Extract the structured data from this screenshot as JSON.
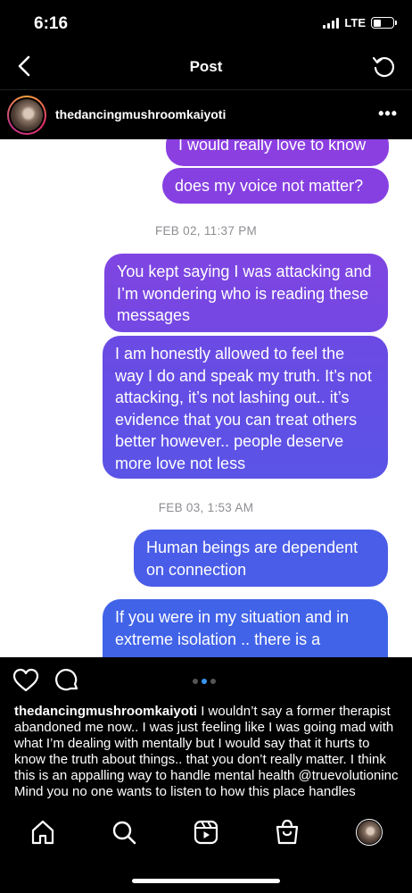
{
  "status_bar": {
    "time": "6:16",
    "network": "LTE",
    "battery_level": 0.4
  },
  "nav": {
    "title": "Post",
    "back_icon": "chevron-left-icon",
    "refresh_icon": "refresh-icon"
  },
  "author": {
    "username": "thedancingmushroomkaiyoti",
    "more_icon": "more-horizontal-icon",
    "more_label": "•••"
  },
  "post_image": {
    "messages": [
      {
        "text": "I would really love to know"
      },
      {
        "text": "does my voice not matter?"
      },
      {
        "timestamp": "FEB 02, 11:37 PM"
      },
      {
        "text": "You kept saying I was attacking and I’m wondering who is reading these messages"
      },
      {
        "text": "I am honestly allowed to feel the way I do and speak my truth. It’s not attacking, it’s not lashing out.. it’s evidence that you can treat others better however.. people deserve more love not less"
      },
      {
        "timestamp": "FEB 03, 1:53 AM"
      },
      {
        "text": "Human beings are dependent on connection"
      },
      {
        "text": "If you were in my situation and in extreme isolation .. there is a"
      }
    ]
  },
  "actions": {
    "like_icon": "heart-icon",
    "comment_icon": "comment-icon",
    "carousel": {
      "count": 3,
      "active_index": 1
    }
  },
  "caption": {
    "username": "thedancingmushroomkaiyoti",
    "text": "I wouldn’t say a former therapist abandoned me now.. I was just feeling like I was going mad with what I’m dealing with mentally but I would say that it hurts to know the truth about things.. that you don’t really matter. I think this is an appalling way to handle mental health @truevolutioninc",
    "text_more": "Mind you no one wants to listen to how this place handles"
  },
  "tabbar": {
    "items": [
      "home-icon",
      "search-icon",
      "reels-icon",
      "shop-icon",
      "profile-avatar"
    ]
  },
  "colors": {
    "bubble_top": "#8b3fe0",
    "bubble_bottom": "#3f63e8",
    "timestamp": "#8e8e93"
  }
}
